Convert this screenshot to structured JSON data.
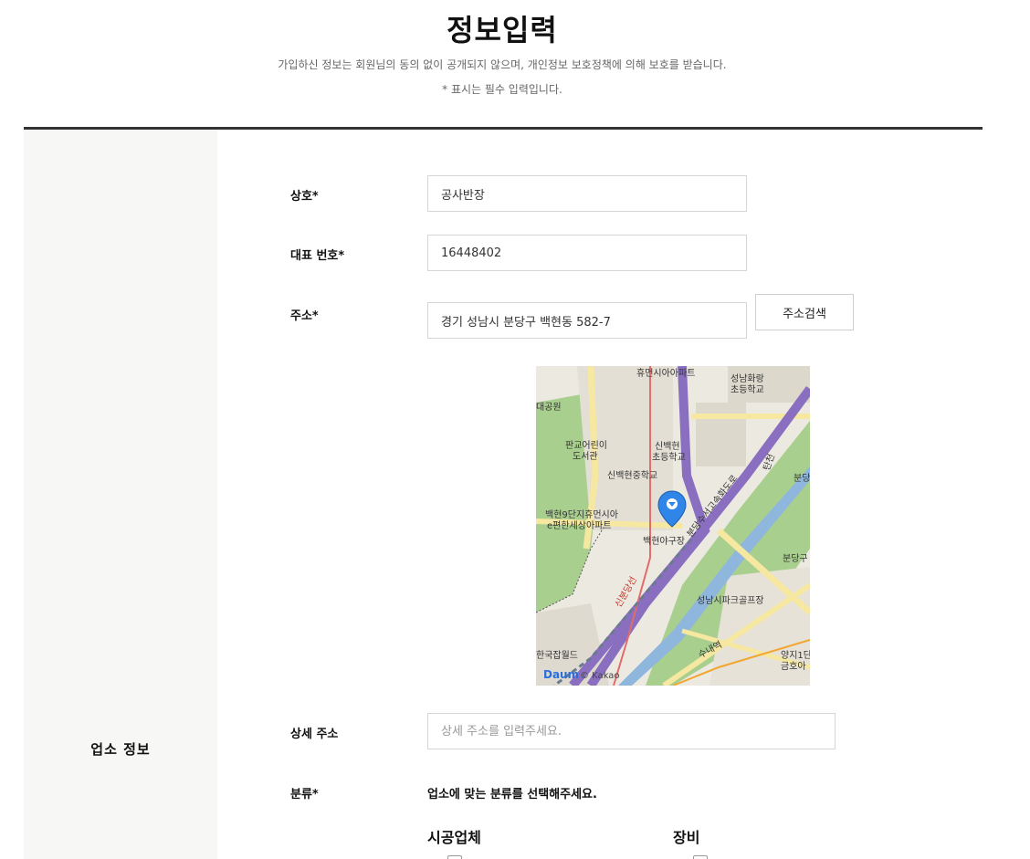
{
  "header": {
    "title": "정보입력",
    "notice": "가입하신 정보는 회원님의 동의 없이 공개되지 않으며, 개인정보 보호정책에 의해 보호를 받습니다.",
    "required_note": "* 표시는 필수 입력입니다."
  },
  "section": {
    "label": "업소 정보"
  },
  "form": {
    "business_name": {
      "label": "상호*",
      "value": "공사반장"
    },
    "phone": {
      "label": "대표 번호*",
      "value": "16448402"
    },
    "address": {
      "label": "주소*",
      "value": "경기 성남시 분당구 백현동 582-7",
      "search_button": "주소검색"
    },
    "detail_address": {
      "label": "상세 주소",
      "placeholder": "상세 주소를 입력주세요."
    },
    "category": {
      "label": "분류*",
      "hint": "업소에 맞는 분류를 선택해주세요.",
      "groups": [
        "시공업체",
        "장비"
      ]
    }
  },
  "map": {
    "labels": {
      "hyumunsi": "휴먼시아아파트",
      "seongnam_hwarang": "성남화랑",
      "seongnam_hwarang_2": "초등학교",
      "park": "대공원",
      "pangyo_library": "판교어린이",
      "pangyo_library_2": "도서관",
      "baekhyun_elem": "신백현",
      "baekhyun_elem_2": "초등학교",
      "baekhyun_middle": "신백현중학교",
      "baekhyun9": "백현9단지휴먼시아",
      "baekhyun9_2": "e편한세상아파트",
      "baekhyun_field": "백현야구장",
      "seongnam_golf": "성남시파크골프장",
      "bundang": "분당",
      "bundang_2": "분당구",
      "tancheon": "탄천",
      "expressway": "분당수서고속화도로",
      "sinbundang": "신분당선",
      "world": "한국잡월드",
      "yangji": "양지1단",
      "geumho": "금호아",
      "suinline": "수내역",
      "brand": "Daum",
      "copyright": "© Kakao"
    },
    "colors": {
      "road_major": "#8a6fc0",
      "road_yellow": "#f6e7a1",
      "green": "#a9cf8e",
      "water": "#8fb6dc",
      "base": "#ece9e1",
      "marker": "#2f86e8"
    }
  }
}
